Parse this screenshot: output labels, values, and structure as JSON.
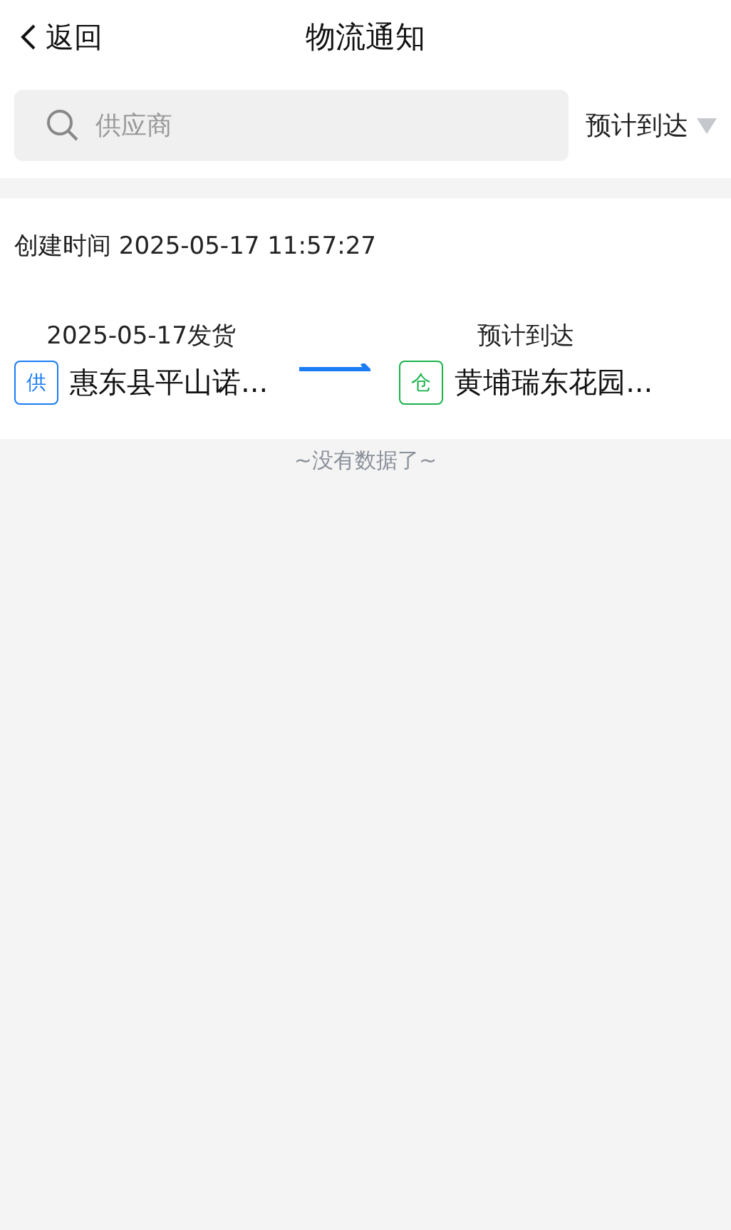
{
  "header": {
    "back_label": "返回",
    "title": "物流通知"
  },
  "search": {
    "placeholder": "供应商"
  },
  "filter": {
    "label": "预计到达"
  },
  "notices": [
    {
      "created": "创建时间 2025-05-17 11:57:27",
      "endpoints": [
        {
          "caption": "2025-05-17发货",
          "tag": "供",
          "color": "#1a7cf5",
          "name": "惠东县平山诺..."
        },
        {
          "caption": "预计到达",
          "tag": "仓",
          "color": "#19b34a",
          "name": "黄埔瑞东花园..."
        }
      ]
    }
  ],
  "footer": "~没有数据了~"
}
